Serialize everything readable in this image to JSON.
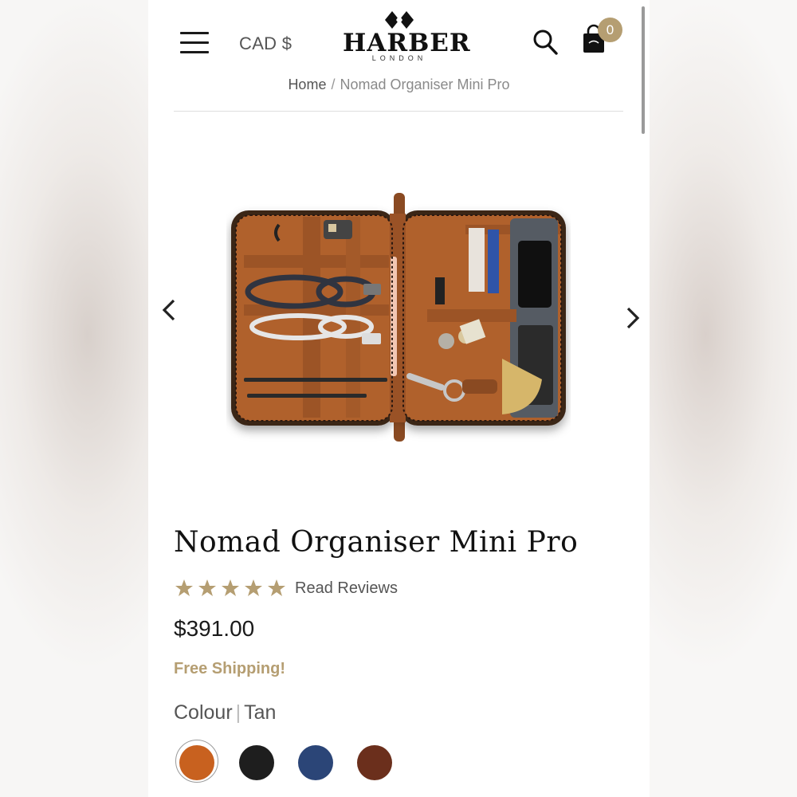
{
  "header": {
    "currency": "CAD $",
    "logo_word": "HARBER",
    "logo_sub": "LONDON",
    "cart_count": "0"
  },
  "breadcrumb": {
    "home": "Home",
    "separator": "/",
    "current": "Nomad Organiser Mini Pro"
  },
  "product": {
    "title": "Nomad Organiser Mini Pro",
    "rating_stars": 5,
    "reviews_link": "Read Reviews",
    "price": "$391.00",
    "shipping": "Free Shipping!",
    "colour_label": "Colour",
    "colour_value": "Tan",
    "swatches": [
      {
        "name": "tan",
        "color": "#c8611f",
        "selected": true
      },
      {
        "name": "black",
        "color": "#1e1e1e",
        "selected": false
      },
      {
        "name": "navy",
        "color": "#2b4577",
        "selected": false
      },
      {
        "name": "brown",
        "color": "#6b2f1c",
        "selected": false
      }
    ]
  },
  "colors": {
    "accent_gold": "#b59e72",
    "text_dark": "#111111"
  },
  "icons": [
    "hamburger-menu-icon",
    "search-icon",
    "shopping-bag-icon",
    "chevron-left-icon",
    "chevron-right-icon",
    "star-icon"
  ]
}
